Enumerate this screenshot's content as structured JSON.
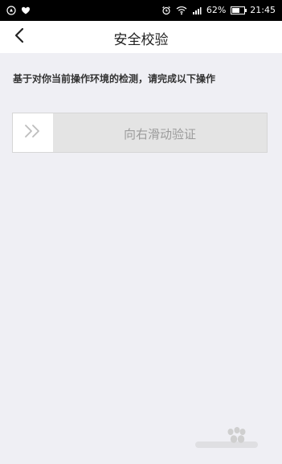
{
  "status_bar": {
    "battery_percent": "62%",
    "time": "21:45",
    "battery_level": 0.62,
    "left_icons": [
      "cellular-data-icon",
      "heart-icon"
    ],
    "right_icons": [
      "alarm-icon",
      "wifi-icon",
      "signal-icon",
      "battery-icon"
    ]
  },
  "header": {
    "title": "安全校验",
    "back_icon": "chevron-left-icon"
  },
  "instruction": "基于对你当前操作环境的检测，请完成以下操作",
  "slider": {
    "label": "向右滑动验证",
    "handle_icon": "double-chevron-right-icon"
  },
  "colors": {
    "background": "#efeff4",
    "status_bar": "#000000",
    "header": "#ffffff",
    "slider_track": "#e4e4e4",
    "slider_text": "#9b9b9b",
    "chevron": "#bdbdbd"
  }
}
